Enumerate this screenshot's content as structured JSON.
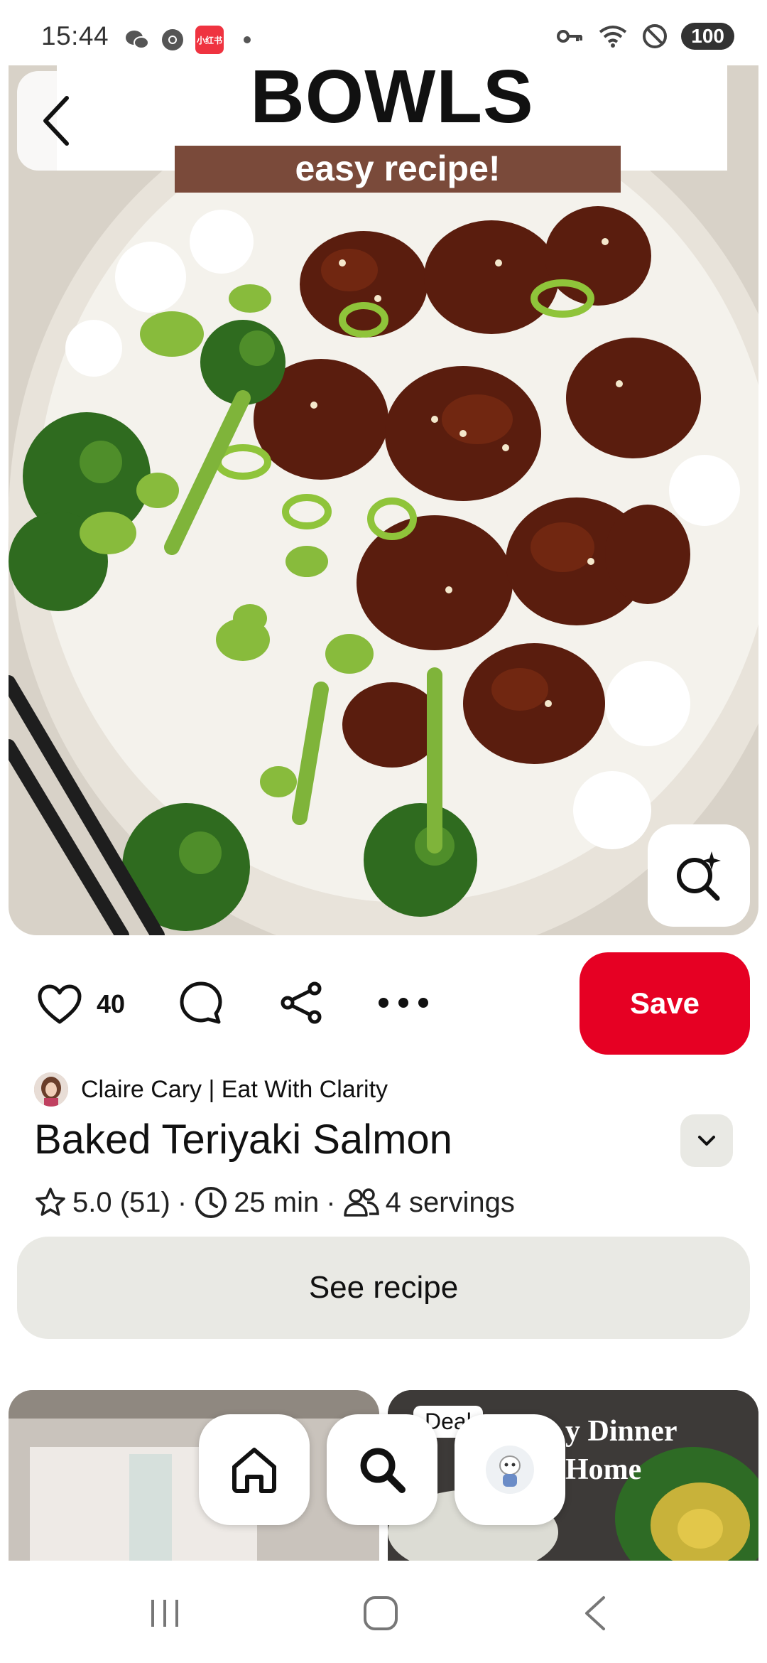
{
  "status_bar": {
    "time": "15:44",
    "battery": "100",
    "icons": [
      "wechat-icon",
      "chrome-icon",
      "xiaohongshu-icon",
      "notification-dot",
      "key-icon",
      "wifi-icon",
      "dnd-icon"
    ]
  },
  "hero": {
    "title": "BOWLS",
    "subtitle": "easy recipe!"
  },
  "actions": {
    "like_count": "40",
    "save_label": "Save"
  },
  "pin": {
    "creator": "Claire Cary | Eat With Clarity",
    "title": "Baked Teriyaki Salmon",
    "rating": "5.0 (51)",
    "time": "25 min",
    "servings": "4 servings",
    "separator": "·",
    "see_recipe_label": "See recipe"
  },
  "related": {
    "deal_label": "Deal",
    "card2_line1": "y Dinner",
    "card2_line2": "Home"
  },
  "colors": {
    "save_red": "#e60023",
    "button_grey": "#e9e9e4",
    "subtitle_band": "#7a4a3a"
  }
}
